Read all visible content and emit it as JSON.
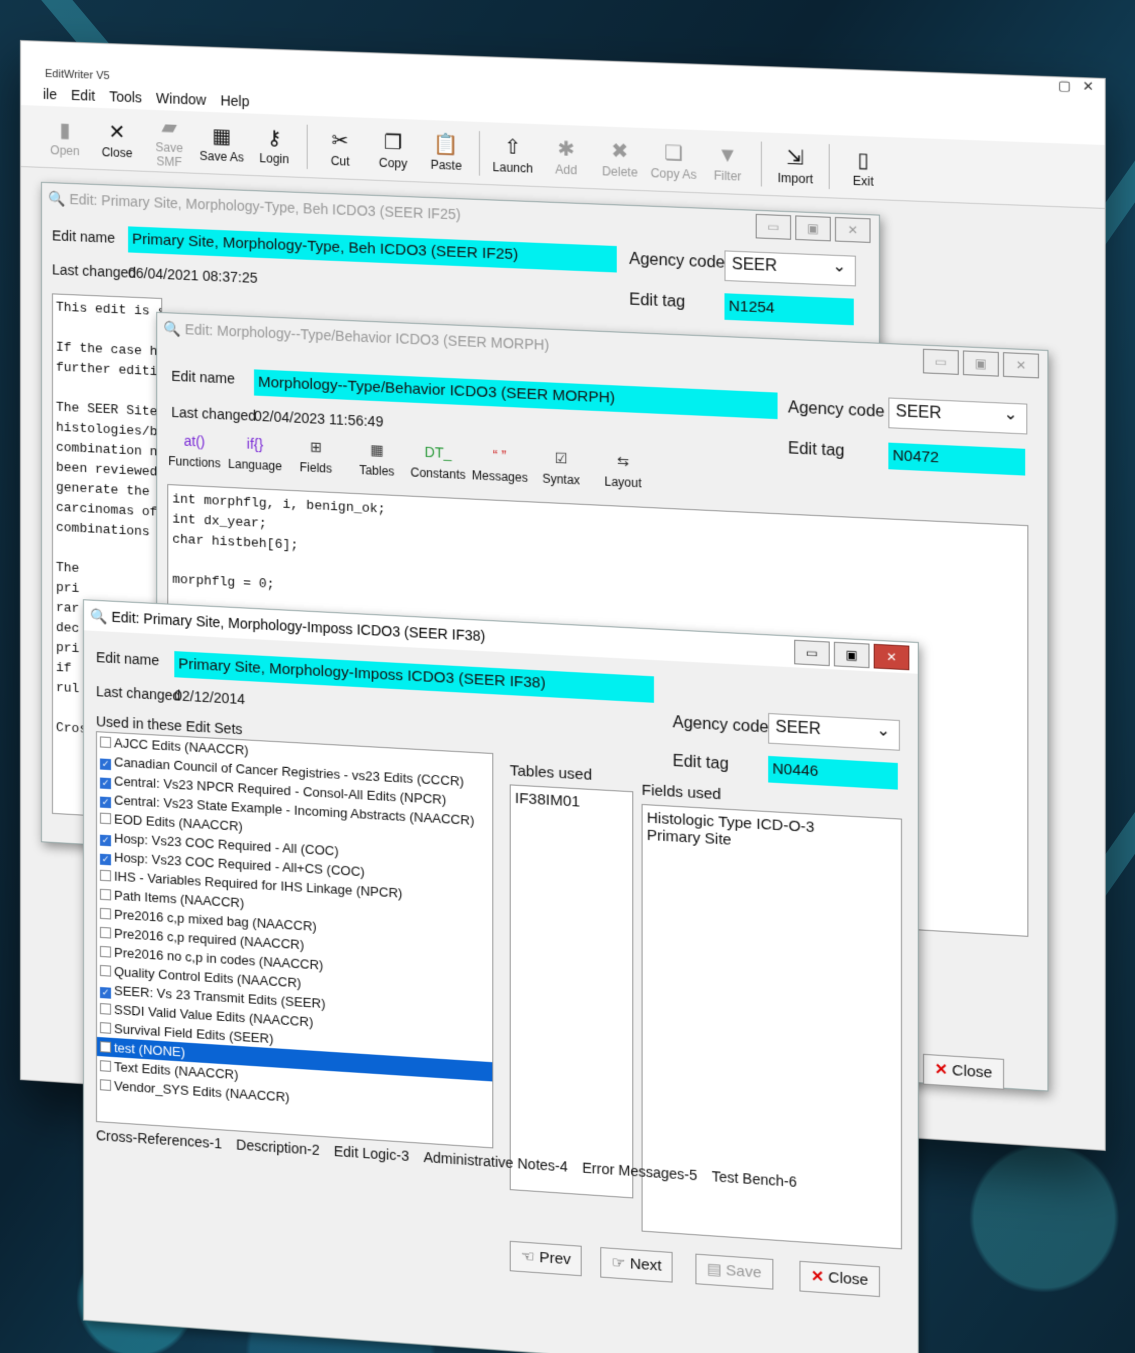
{
  "app": {
    "title": "EditWriter V5"
  },
  "menu": [
    "ile",
    "Edit",
    "Tools",
    "Window",
    "Help"
  ],
  "toolbar": [
    {
      "label": "Open",
      "icon": "open-icon",
      "glyph": "▮",
      "enabled": false
    },
    {
      "label": "Close",
      "icon": "close-doc-icon",
      "glyph": "✕",
      "enabled": true
    },
    {
      "label": "Save SMF",
      "icon": "save-smf-icon",
      "glyph": "▰",
      "enabled": false
    },
    {
      "label": "Save As",
      "icon": "save-as-icon",
      "glyph": "▦",
      "enabled": true
    },
    {
      "label": "Login",
      "icon": "key-icon",
      "glyph": "⚷",
      "enabled": true
    },
    {
      "label": "Cut",
      "icon": "scissors-icon",
      "glyph": "✂",
      "enabled": true
    },
    {
      "label": "Copy",
      "icon": "copy-icon",
      "glyph": "❐",
      "enabled": true
    },
    {
      "label": "Paste",
      "icon": "paste-icon",
      "glyph": "📋",
      "enabled": true
    },
    {
      "label": "Launch",
      "icon": "rocket-icon",
      "glyph": "⇧",
      "enabled": true
    },
    {
      "label": "Add",
      "icon": "add-icon",
      "glyph": "✱",
      "enabled": false
    },
    {
      "label": "Delete",
      "icon": "delete-icon",
      "glyph": "✖",
      "enabled": false
    },
    {
      "label": "Copy As",
      "icon": "copy-as-icon",
      "glyph": "❏",
      "enabled": false
    },
    {
      "label": "Filter",
      "icon": "filter-icon",
      "glyph": "▼",
      "enabled": false
    },
    {
      "label": "Import",
      "icon": "import-icon",
      "glyph": "⇲",
      "enabled": true
    },
    {
      "label": "Exit",
      "icon": "exit-door-icon",
      "glyph": "▯",
      "enabled": true
    }
  ],
  "win1": {
    "title": "Edit: Primary Site, Morphology-Type, Beh ICDO3 (SEER IF25)",
    "edit_name_label": "Edit name",
    "edit_name": "Primary Site, Morphology-Type, Beh ICDO3 (SEER IF25)",
    "last_changed_label": "Last changed",
    "last_changed": "06/04/2021 08:37:25",
    "agency_label": "Agency code",
    "agency": "SEER",
    "tag_label": "Edit tag",
    "tag": "N1254",
    "desc": [
      "This edit is sk",
      "",
      "If the case has",
      "further editing",
      "",
      "The SEER Site/H",
      "histologies/beh",
      "combination not",
      "been reviewed,",
      "generate the me",
      "carcinomas of m",
      "combinations do",
      "",
      "The",
      "pri",
      "rar",
      "dec",
      "pri",
      "if",
      "rul",
      "",
      "Cros"
    ]
  },
  "win2": {
    "title": "Edit: Morphology--Type/Behavior ICDO3 (SEER MORPH)",
    "edit_name_label": "Edit name",
    "edit_name": "Morphology--Type/Behavior ICDO3 (SEER MORPH)",
    "last_changed_label": "Last changed",
    "last_changed": "02/04/2023 11:56:49",
    "agency_label": "Agency code",
    "agency": "SEER",
    "tag_label": "Edit tag",
    "tag": "N0472",
    "tools": [
      {
        "label": "Functions",
        "glyph": "at()"
      },
      {
        "label": "Language",
        "glyph": "if{}"
      },
      {
        "label": "Fields",
        "glyph": "⊞"
      },
      {
        "label": "Tables",
        "glyph": "▦"
      },
      {
        "label": "Constants",
        "glyph": "DT_"
      },
      {
        "label": "Messages",
        "glyph": "“ ”"
      },
      {
        "label": "Syntax",
        "glyph": "☑"
      },
      {
        "label": "Layout",
        "glyph": "⇆"
      }
    ],
    "code": [
      "int morphflg, i, benign_ok;",
      "int dx_year;",
      "char histbeh[6];",
      "",
      "morphflg = 0;"
    ],
    "close_label": "Close"
  },
  "win3": {
    "title": "Edit: Primary Site, Morphology-Imposs ICDO3 (SEER IF38)",
    "edit_name_label": "Edit name",
    "edit_name": "Primary Site, Morphology-Imposs ICDO3 (SEER IF38)",
    "last_changed_label": "Last changed",
    "last_changed": "02/12/2014",
    "agency_label": "Agency code",
    "agency": "SEER",
    "tag_label": "Edit tag",
    "tag": "N0446",
    "used_label": "Used in these Edit Sets",
    "edit_sets": [
      {
        "label": "AJCC Edits (NAACCR)",
        "checked": false
      },
      {
        "label": "Canadian Council of Cancer Registries - vs23 Edits (CCCR)",
        "checked": true
      },
      {
        "label": "Central: Vs23 NPCR Required - Consol-All Edits (NPCR)",
        "checked": true
      },
      {
        "label": "Central: Vs23 State Example - Incoming Abstracts (NAACCR)",
        "checked": true
      },
      {
        "label": "EOD Edits (NAACCR)",
        "checked": false
      },
      {
        "label": "Hosp: Vs23 COC Required - All (COC)",
        "checked": true
      },
      {
        "label": "Hosp: Vs23 COC Required - All+CS (COC)",
        "checked": true
      },
      {
        "label": "IHS - Variables Required for IHS Linkage (NPCR)",
        "checked": false
      },
      {
        "label": "Path Items (NAACCR)",
        "checked": false
      },
      {
        "label": "Pre2016 c,p mixed bag (NAACCR)",
        "checked": false
      },
      {
        "label": "Pre2016 c,p required (NAACCR)",
        "checked": false
      },
      {
        "label": "Pre2016 no c,p in codes (NAACCR)",
        "checked": false
      },
      {
        "label": "Quality Control Edits (NAACCR)",
        "checked": false
      },
      {
        "label": "SEER: Vs 23 Transmit Edits (SEER)",
        "checked": true
      },
      {
        "label": "SSDI Valid Value Edits (NAACCR)",
        "checked": false
      },
      {
        "label": "Survival Field Edits (SEER)",
        "checked": false
      },
      {
        "label": "test (NONE)",
        "checked": false,
        "selected": true
      },
      {
        "label": "Text Edits (NAACCR)",
        "checked": false
      },
      {
        "label": "Vendor_SYS Edits (NAACCR)",
        "checked": false
      }
    ],
    "tables_label": "Tables used",
    "tables": [
      "IF38IM01"
    ],
    "fields_label": "Fields used",
    "fields": [
      "Histologic Type ICD-O-3",
      "Primary Site"
    ],
    "tabs": [
      "Cross-References-1",
      "Description-2",
      "Edit Logic-3",
      "Administrative Notes-4",
      "Error Messages-5",
      "Test Bench-6"
    ],
    "prev_label": "Prev",
    "next_label": "Next",
    "save_label": "Save",
    "close_label": "Close"
  }
}
